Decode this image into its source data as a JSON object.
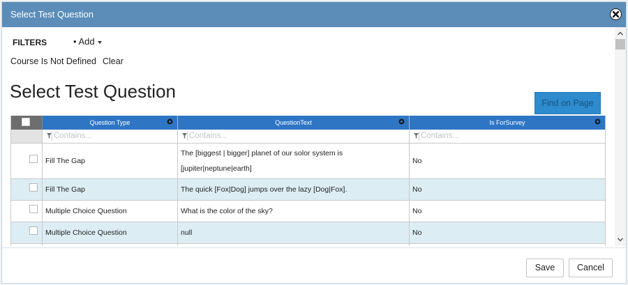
{
  "dialog": {
    "title": "Select Test Question"
  },
  "filters": {
    "label": "FILTERS",
    "add_label": "• Add"
  },
  "course": {
    "status": "Course Is Not Defined",
    "clear_label": "Clear"
  },
  "page_title": "Select Test Question",
  "find_button": "Find on Page",
  "grid": {
    "columns": [
      "Question Type",
      "QuestionText",
      "Is ForSurvey"
    ],
    "filter_placeholder": "Contains...",
    "rows": [
      {
        "type": "Fill The Gap",
        "text": "The [biggest | bigger] planet of our solor system is [jupiter|neptune|earth]",
        "survey": "No"
      },
      {
        "type": "Fill The Gap",
        "text": "The quick [Fox|Dog] jumps over the lazy [Dog|Fox].",
        "survey": "No"
      },
      {
        "type": "Multiple Choice Question",
        "text": "What is the color of the sky?",
        "survey": "No"
      },
      {
        "type": "Multiple Choice Question",
        "text": "null",
        "survey": "No"
      }
    ]
  },
  "footer": {
    "save_label": "Save",
    "cancel_label": "Cancel"
  },
  "colors": {
    "titlebar": "#5b8db8",
    "grid_header": "#2e75c4",
    "alt_row": "#dcedf4",
    "find_button": "#2e8bce"
  }
}
